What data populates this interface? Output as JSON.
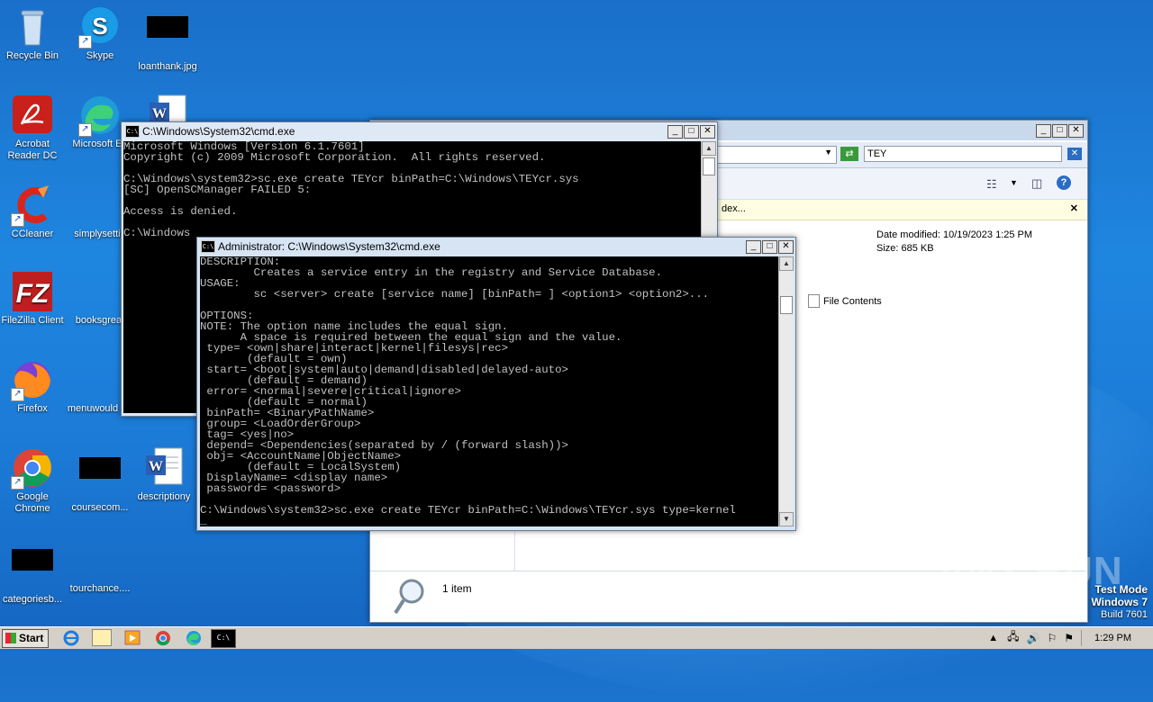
{
  "desktop": {
    "icons": [
      {
        "label": "Recycle Bin",
        "icon": "recycle-bin-icon"
      },
      {
        "label": "Skype",
        "icon": "skype-icon"
      },
      {
        "label": "loanthank.jpg",
        "icon": "image-file-icon"
      },
      {
        "label": "Acrobat Reader DC",
        "label2": "Reader DC",
        "label1": "Acrobat",
        "icon": "acrobat-icon"
      },
      {
        "label": "Microsoft Ed",
        "icon": "edge-icon"
      },
      {
        "label": "CCleaner",
        "icon": "ccleaner-icon"
      },
      {
        "label": "simplysettin",
        "icon": "file-icon"
      },
      {
        "label": "FileZilla Client",
        "icon": "filezilla-icon"
      },
      {
        "label": "booksgreat",
        "icon": "file-icon"
      },
      {
        "label": "Firefox",
        "icon": "firefox-icon"
      },
      {
        "label": "menuwould",
        "icon": "file-icon"
      },
      {
        "label1": "Google",
        "label2": "Chrome",
        "icon": "chrome-icon"
      },
      {
        "label": "coursecom...",
        "icon": "image-file-icon"
      },
      {
        "label": "descriptiony",
        "icon": "word-icon"
      },
      {
        "label": "categoriesb...",
        "icon": "image-file-icon"
      },
      {
        "label": "tourchance....",
        "icon": "file-icon"
      }
    ]
  },
  "cmd1": {
    "title": "C:\\Windows\\System32\\cmd.exe",
    "lines": [
      "Microsoft Windows [Version 6.1.7601]",
      "Copyright (c) 2009 Microsoft Corporation.  All rights reserved.",
      "",
      "C:\\Windows\\system32>sc.exe create TEYcr binPath=C:\\Windows\\TEYcr.sys",
      "[SC] OpenSCManager FAILED 5:",
      "",
      "Access is denied.",
      "",
      "C:\\Windows"
    ]
  },
  "cmd2": {
    "title": "Administrator: C:\\Windows\\System32\\cmd.exe",
    "lines": [
      "DESCRIPTION:",
      "        Creates a service entry in the registry and Service Database.",
      "USAGE:",
      "        sc <server> create [service name] [binPath= ] <option1> <option2>...",
      "",
      "OPTIONS:",
      "NOTE: The option name includes the equal sign.",
      "      A space is required between the equal sign and the value.",
      " type= <own|share|interact|kernel|filesys|rec>",
      "       (default = own)",
      " start= <boot|system|auto|demand|disabled|delayed-auto>",
      "       (default = demand)",
      " error= <normal|severe|critical|ignore>",
      "       (default = normal)",
      " binPath= <BinaryPathName>",
      " group= <LoadOrderGroup>",
      " tag= <yes|no>",
      " depend= <Dependencies(separated by / (forward slash))>",
      " obj= <AccountName|ObjectName>",
      "       (default = LocalSystem)",
      " DisplayName= <display name>",
      " password= <password>",
      "",
      "C:\\Windows\\system32>sc.exe create TEYcr binPath=C:\\Windows\\TEYcr.sys type=kernel",
      "_"
    ]
  },
  "explorer": {
    "search_value": "TEY",
    "info_bar": "dex...",
    "date_modified": "Date modified: 10/19/2023 1:25 PM",
    "size": "Size: 685 KB",
    "file_contents": "File Contents",
    "status": "1 item"
  },
  "watermark": {
    "brand": "ANY RUN",
    "test_mode": "Test Mode",
    "os": "Windows 7",
    "build": "Build 7601"
  },
  "taskbar": {
    "start_label": "Start",
    "clock": "1:29 PM"
  }
}
